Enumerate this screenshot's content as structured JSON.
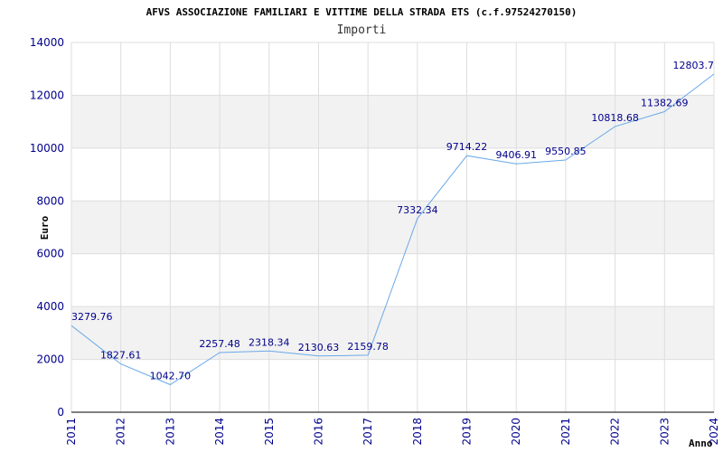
{
  "chart_data": {
    "type": "line",
    "title": "AFVS ASSOCIAZIONE FAMILIARI E VITTIME DELLA STRADA ETS (c.f.97524270150)",
    "subtitle": "Importi",
    "ylabel": "Euro",
    "xlabel": "Anno",
    "ylim": [
      0,
      14000
    ],
    "yticks": [
      "0",
      "2000",
      "4000",
      "6000",
      "8000",
      "10000",
      "12000",
      "14000"
    ],
    "grid": "alternating horizontal bands",
    "categories": [
      "2011",
      "2012",
      "2013",
      "2014",
      "2015",
      "2016",
      "2017",
      "2018",
      "2019",
      "2020",
      "2021",
      "2022",
      "2023",
      "2024"
    ],
    "values": [
      3279.76,
      1827.61,
      1042.7,
      2257.48,
      2318.34,
      2130.63,
      2159.78,
      7332.34,
      9714.22,
      9406.91,
      9550.85,
      10818.68,
      11382.69,
      12803.7
    ],
    "labels": [
      "3279.76",
      "1827.61",
      "1042.70",
      "2257.48",
      "2318.34",
      "2130.63",
      "2159.78",
      "7332.34",
      "9714.22",
      "9406.91",
      "9550.85",
      "10818.68",
      "11382.69",
      "12803.7"
    ],
    "colors": {
      "line": "#6aa9e8",
      "band": "#f2f2f2",
      "axis_text": "#00008b",
      "grid": "#dddddd"
    }
  }
}
